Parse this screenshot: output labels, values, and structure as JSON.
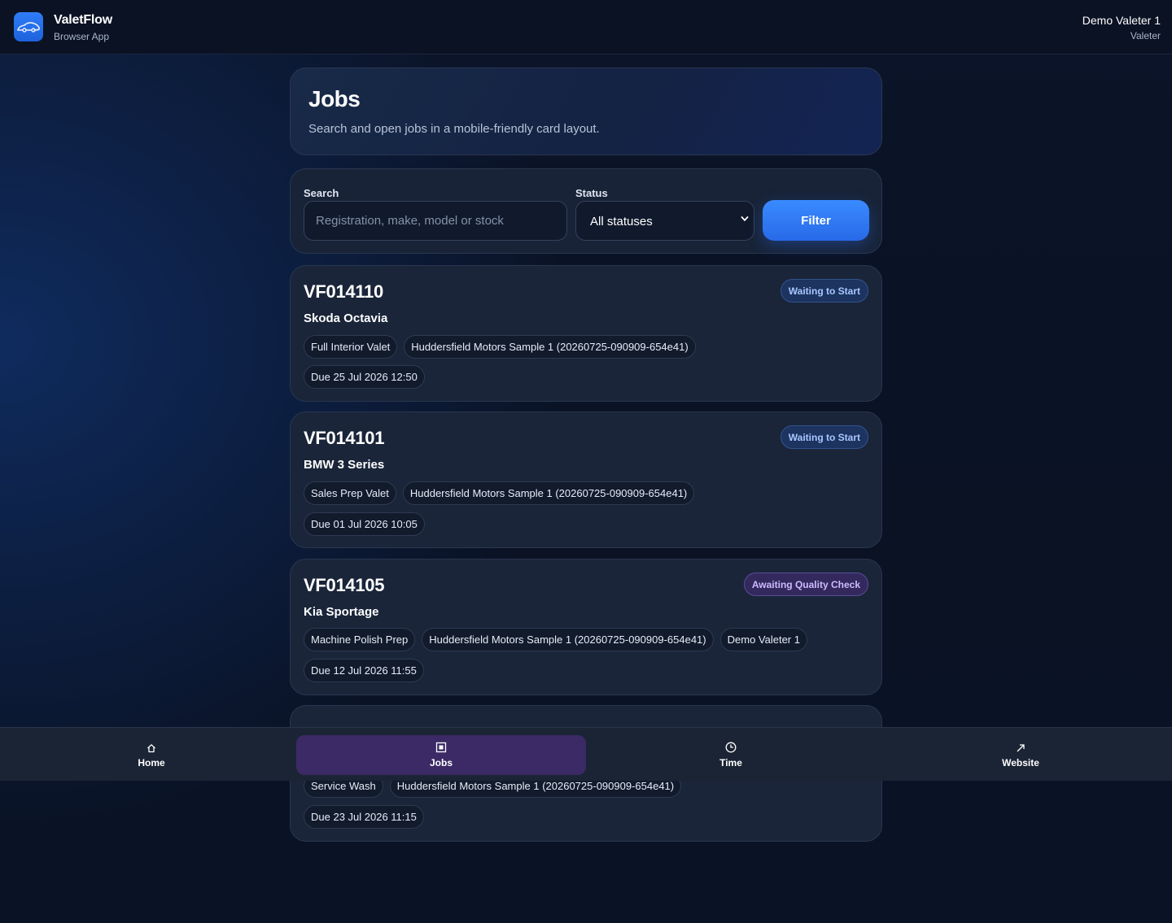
{
  "header": {
    "app_name": "ValetFlow",
    "app_sub": "Browser App",
    "user_name": "Demo Valeter 1",
    "user_role": "Valeter"
  },
  "hero": {
    "title": "Jobs",
    "subtitle": "Search and open jobs in a mobile-friendly card layout."
  },
  "filters": {
    "search_label": "Search",
    "search_placeholder": "Registration, make, model or stock",
    "search_value": "",
    "status_label": "Status",
    "status_value": "All statuses",
    "filter_button": "Filter"
  },
  "jobs": [
    {
      "id": "VF014110",
      "vehicle": "Skoda Octavia",
      "status": "Waiting to Start",
      "service": "Full Interior Valet",
      "dealer": "Huddersfield Motors Sample 1 (20260725-090909-654e41)",
      "assignee": "",
      "due": "Due 25 Jul 2026 12:50"
    },
    {
      "id": "VF014101",
      "vehicle": "BMW 3 Series",
      "status": "Waiting to Start",
      "service": "Sales Prep Valet",
      "dealer": "Huddersfield Motors Sample 1 (20260725-090909-654e41)",
      "assignee": "",
      "due": "Due 01 Jul 2026 10:05"
    },
    {
      "id": "VF014105",
      "vehicle": "Kia Sportage",
      "status": "Awaiting Quality Check",
      "service": "Machine Polish Prep",
      "dealer": "Huddersfield Motors Sample 1 (20260725-090909-654e41)",
      "assignee": "Demo Valeter 1",
      "due": "Due 12 Jul 2026 11:55"
    },
    {
      "id": "",
      "vehicle": "",
      "status": "",
      "service": "Service Wash",
      "dealer": "Huddersfield Motors Sample 1 (20260725-090909-654e41)",
      "assignee": "",
      "due": "Due 23 Jul 2026 11:15"
    }
  ],
  "nav": {
    "home": "Home",
    "jobs": "Jobs",
    "time": "Time",
    "website": "Website",
    "active": "jobs"
  },
  "colors": {
    "accent": "#2f7cf6",
    "badge_waiting": "#a8c7ff",
    "badge_qc": "#cdbbff",
    "nav_active": "#3b2a66"
  }
}
